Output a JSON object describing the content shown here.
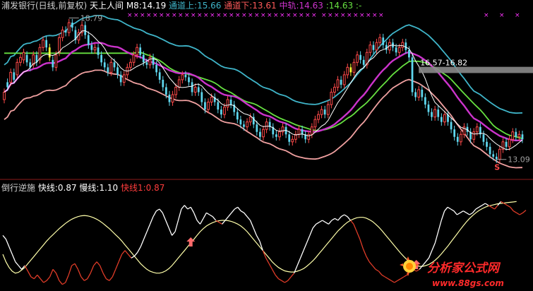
{
  "colors": {
    "background": "#000000",
    "separator": "#8b1a1a",
    "up_candle": "#ff4a4a",
    "down_candle": "#5fd7ee",
    "signal_candle": "#ffff33",
    "upper_band": "#3fb4c8",
    "mid_rail": "#cc33cc",
    "lower_band": "#f0a0a0",
    "m8": "#ffffff",
    "hl_lines": "#a0a0a0",
    "green_line": "#66e040",
    "fast_line": "#ffffaa",
    "slow_line_red": "#e03c28",
    "slow_line_white": "#ffffff",
    "marker_x": "#ff33ff",
    "band_line_sample": "#a0a0a0",
    "arrow": "#ff6a6a",
    "watermark": "#ff2a2a"
  },
  "main_panel": {
    "legend": [
      {
        "text": "浦发银行(日线,前复权)",
        "color": "#cfcfcf"
      },
      {
        "text": "天上人间",
        "color": "#ffffff"
      },
      {
        "text": "M8:14.19",
        "color": "#ffffff"
      },
      {
        "text": "通道上:15.66",
        "color": "#3fb4c8"
      },
      {
        "text": "通道下:13.61",
        "color": "#ff5a5a"
      },
      {
        "text": "中轨:14.63",
        "color": "#cc33cc"
      },
      {
        "text": ":14.63",
        "color": "#66e040"
      },
      {
        "text": ":-",
        "color": "#66e040"
      }
    ],
    "annotations": {
      "high_label": "18.79",
      "low_label": "13.09",
      "range_label": "16.57-16.82",
      "s_label": "S"
    }
  },
  "sub_panel": {
    "legend": [
      {
        "text": "倒行逆施",
        "color": "#cfcfcf"
      },
      {
        "text": "快线:0.87",
        "color": "#ffffff"
      },
      {
        "text": "慢线:1.10",
        "color": "#ffffff"
      },
      {
        "text": "快线1:0.87",
        "color": "#ff3c3c"
      }
    ]
  },
  "watermark": {
    "title": "分析家公式网",
    "url": "www.88gs.com"
  },
  "chart_data": [
    {
      "type": "candlestick",
      "title": "浦发银行(日线,前复权)",
      "ylim": [
        12.4,
        19.0
      ],
      "annotations": {
        "max": 18.79,
        "min": 13.09,
        "range": [
          16.57,
          16.82
        ]
      },
      "close": [
        15.8,
        16.0,
        16.6,
        16.3,
        17.0,
        17.2,
        17.4,
        17.0,
        16.8,
        17.3,
        17.0,
        17.6,
        17.9,
        17.6,
        17.2,
        16.8,
        17.3,
        18.0,
        18.3,
        18.2,
        18.6,
        18.4,
        17.9,
        18.2,
        18.5,
        18.1,
        17.7,
        17.5,
        17.6,
        17.3,
        17.0,
        16.8,
        16.6,
        17.0,
        16.8,
        16.5,
        16.2,
        16.5,
        16.8,
        17.0,
        17.3,
        17.6,
        17.3,
        17.0,
        16.9,
        17.2,
        16.9,
        16.6,
        16.3,
        16.0,
        15.7,
        15.4,
        15.7,
        16.0,
        16.3,
        16.5,
        16.4,
        16.2,
        15.8,
        16.0,
        15.8,
        15.4,
        15.1,
        15.4,
        15.6,
        15.4,
        15.1,
        14.9,
        15.2,
        15.5,
        15.3,
        15.0,
        14.7,
        14.5,
        14.4,
        14.6,
        14.8,
        14.5,
        14.2,
        14.0,
        14.3,
        14.6,
        14.4,
        14.1,
        14.0,
        14.2,
        14.4,
        14.1,
        13.8,
        13.9,
        14.1,
        14.3,
        14.1,
        13.9,
        14.1,
        14.4,
        14.7,
        14.9,
        15.1,
        14.9,
        15.3,
        15.8,
        16.0,
        16.3,
        16.1,
        16.5,
        16.8,
        16.6,
        17.0,
        17.3,
        17.1,
        16.9,
        17.4,
        17.7,
        17.5,
        17.8,
        18.0,
        17.7,
        17.5,
        17.8,
        17.6,
        17.4,
        17.6,
        17.8,
        17.5,
        17.2,
        15.8,
        15.6,
        15.9,
        15.6,
        15.3,
        15.0,
        14.8,
        15.1,
        14.8,
        14.6,
        14.9,
        14.6,
        14.3,
        14.0,
        13.8,
        14.1,
        14.4,
        14.2,
        13.9,
        14.2,
        14.4,
        14.1,
        13.8,
        13.6,
        13.3,
        13.2,
        13.1,
        13.5,
        13.8,
        13.6,
        13.9,
        14.2,
        14.0,
        14.1,
        13.9
      ],
      "open_offset": [
        -0.3,
        0.2,
        -0.4,
        0.3,
        -0.5,
        -0.2,
        -0.3,
        0.3,
        0.2,
        -0.4,
        0.3,
        -0.5,
        -0.3,
        0.3,
        0.4,
        0.3,
        -0.5,
        -0.6,
        -0.3,
        0.1,
        -0.4,
        0.2,
        0.4,
        -0.3,
        -0.3,
        0.4,
        0.4,
        0.2,
        -0.1,
        0.3,
        0.3,
        0.2,
        0.2,
        -0.4,
        0.2,
        0.3,
        0.3,
        -0.3,
        -0.3,
        -0.2,
        -0.3,
        -0.3,
        0.3,
        0.3,
        0.1,
        -0.3,
        0.3,
        0.3,
        0.3,
        0.3,
        0.3,
        0.3,
        -0.3,
        -0.3,
        -0.3,
        -0.2,
        0.1,
        0.2,
        0.4,
        -0.2,
        0.2,
        0.4,
        0.3,
        -0.3,
        -0.2,
        0.2,
        0.3,
        0.2,
        -0.3,
        -0.3,
        0.2,
        0.3,
        0.3,
        0.2,
        0.1,
        -0.2,
        -0.2,
        0.3,
        0.3,
        0.2,
        -0.3,
        -0.3,
        0.2,
        0.3,
        0.1,
        -0.2,
        -0.2,
        0.3,
        0.3,
        -0.1,
        -0.2,
        -0.2,
        0.2,
        0.2,
        -0.2,
        -0.3,
        -0.3,
        -0.2,
        -0.2,
        0.2,
        -0.4,
        -0.5,
        -0.2,
        -0.3,
        0.2,
        -0.4,
        -0.3,
        0.2,
        -0.4,
        -0.3,
        0.2,
        0.2,
        -0.5,
        -0.3,
        0.2,
        -0.3,
        -0.2,
        0.3,
        0.2,
        -0.3,
        0.2,
        0.2,
        -0.2,
        -0.2,
        0.3,
        0.3,
        1.4,
        0.2,
        -0.3,
        0.3,
        0.3,
        0.3,
        0.2,
        -0.3,
        0.3,
        0.2,
        -0.3,
        0.3,
        0.3,
        0.3,
        0.2,
        -0.3,
        -0.3,
        0.2,
        0.3,
        -0.3,
        -0.2,
        0.3,
        0.3,
        0.2,
        0.3,
        0.1,
        0.1,
        -0.4,
        -0.3,
        0.2,
        -0.3,
        -0.3,
        0.2,
        -0.1,
        0.2
      ],
      "signal_indices": [
        14,
        107,
        171
      ],
      "series": [
        {
          "name": "通道上",
          "last": 15.66
        },
        {
          "name": "通道下",
          "last": 13.61
        },
        {
          "name": "中轨",
          "last": 14.63
        },
        {
          "name": "M8",
          "last": 14.19
        }
      ]
    },
    {
      "type": "line",
      "title": "倒行逆施",
      "ylim": [
        -1.2,
        1.2
      ],
      "series": [
        {
          "name": "快线",
          "last": 0.87,
          "values": [
            0.2,
            0.1,
            -0.1,
            -0.3,
            -0.5,
            -0.6,
            -0.7,
            -0.6,
            -0.75,
            -0.9,
            -0.95,
            -0.85,
            -0.95,
            -1.05,
            -1.0,
            -0.9,
            -0.7,
            -0.8,
            -1.0,
            -1.1,
            -1.05,
            -0.85,
            -0.6,
            -0.55,
            -0.7,
            -0.9,
            -1.0,
            -0.95,
            -0.8,
            -0.6,
            -0.5,
            -0.6,
            -0.8,
            -0.95,
            -1.0,
            -0.9,
            -0.7,
            -0.5,
            -0.3,
            -0.2,
            -0.3,
            -0.4,
            -0.35,
            -0.25,
            -0.1,
            0.1,
            0.3,
            0.5,
            0.7,
            0.85,
            0.9,
            0.8,
            0.6,
            0.4,
            0.2,
            0.3,
            0.6,
            0.9,
            1.0,
            0.9,
            0.95,
            0.8,
            0.6,
            0.5,
            0.65,
            0.8,
            0.75,
            0.7,
            0.6,
            0.55,
            0.5,
            0.6,
            0.7,
            0.8,
            0.9,
            0.95,
            0.85,
            0.8,
            0.7,
            0.6,
            0.4,
            0.2,
            0.05,
            -0.2,
            -0.4,
            -0.55,
            -0.7,
            -0.85,
            -0.95,
            -1.0,
            -1.05,
            -1.0,
            -0.9,
            -0.8,
            -0.6,
            -0.4,
            -0.2,
            0.0,
            0.2,
            0.4,
            0.5,
            0.55,
            0.6,
            0.55,
            0.5,
            0.6,
            0.65,
            0.6,
            0.7,
            0.75,
            0.7,
            0.6,
            0.5,
            0.3,
            0.1,
            -0.15,
            -0.35,
            -0.5,
            -0.6,
            -0.7,
            -0.75,
            -0.85,
            -0.9,
            -0.95,
            -1.0,
            -1.05,
            -1.0,
            -0.95,
            -0.9,
            -0.85,
            -0.75,
            -0.7,
            -0.75,
            -0.7,
            -0.6,
            -0.5,
            -0.4,
            -0.2,
            0.0,
            0.3,
            0.6,
            0.85,
            0.95,
            0.9,
            0.85,
            0.75,
            0.8,
            0.85,
            0.8,
            0.75,
            0.8,
            0.9,
            0.95,
            1.0,
            1.05,
            1.0,
            0.95,
            0.9,
            1.0,
            1.1,
            1.05,
            1.0,
            0.95,
            0.85,
            0.8,
            0.75,
            0.8,
            0.87
          ]
        },
        {
          "name": "慢线",
          "last": 1.1,
          "values": [
            -0.3,
            -0.5,
            -0.65,
            -0.75,
            -0.8,
            -0.78,
            -0.72,
            -0.65,
            -0.55,
            -0.45,
            -0.35,
            -0.25,
            -0.15,
            -0.05,
            0.05,
            0.14,
            0.22,
            0.3,
            0.38,
            0.45,
            0.52,
            0.58,
            0.63,
            0.67,
            0.7,
            0.72,
            0.73,
            0.72,
            0.7,
            0.67,
            0.63,
            0.58,
            0.52,
            0.45,
            0.38,
            0.3,
            0.22,
            0.14,
            0.05,
            -0.05,
            -0.15,
            -0.25,
            -0.35,
            -0.45,
            -0.55,
            -0.63,
            -0.7,
            -0.75,
            -0.78,
            -0.8,
            -0.8,
            -0.78,
            -0.74,
            -0.68,
            -0.6,
            -0.5,
            -0.4,
            -0.3,
            -0.2,
            -0.1,
            0.0,
            0.1,
            0.2,
            0.3,
            0.38,
            0.45,
            0.5,
            0.54,
            0.57,
            0.59,
            0.6,
            0.6,
            0.59,
            0.57,
            0.54,
            0.5,
            0.45,
            0.38,
            0.3,
            0.2,
            0.1,
            0.0,
            -0.1,
            -0.2,
            -0.3,
            -0.4,
            -0.5,
            -0.58,
            -0.65,
            -0.7,
            -0.74,
            -0.76,
            -0.77,
            -0.77,
            -0.75,
            -0.72,
            -0.68,
            -0.62,
            -0.55,
            -0.47,
            -0.38,
            -0.28,
            -0.18,
            -0.08,
            0.02,
            0.12,
            0.22,
            0.32,
            0.4,
            0.48,
            0.55,
            0.6,
            0.64,
            0.67,
            0.68,
            0.68,
            0.66,
            0.62,
            0.57,
            0.5,
            0.42,
            0.33,
            0.23,
            0.13,
            0.03,
            -0.07,
            -0.17,
            -0.27,
            -0.36,
            -0.44,
            -0.51,
            -0.56,
            -0.6,
            -0.62,
            -0.62,
            -0.6,
            -0.57,
            -0.52,
            -0.46,
            -0.38,
            -0.29,
            -0.19,
            -0.09,
            0.02,
            0.13,
            0.24,
            0.35,
            0.46,
            0.56,
            0.65,
            0.73,
            0.8,
            0.86,
            0.91,
            0.95,
            0.98,
            1.0,
            1.02,
            1.04,
            1.05,
            1.06,
            1.07,
            1.08,
            1.09,
            1.1
          ]
        }
      ],
      "arrows_at": [
        60,
        132,
        170
      ]
    }
  ]
}
